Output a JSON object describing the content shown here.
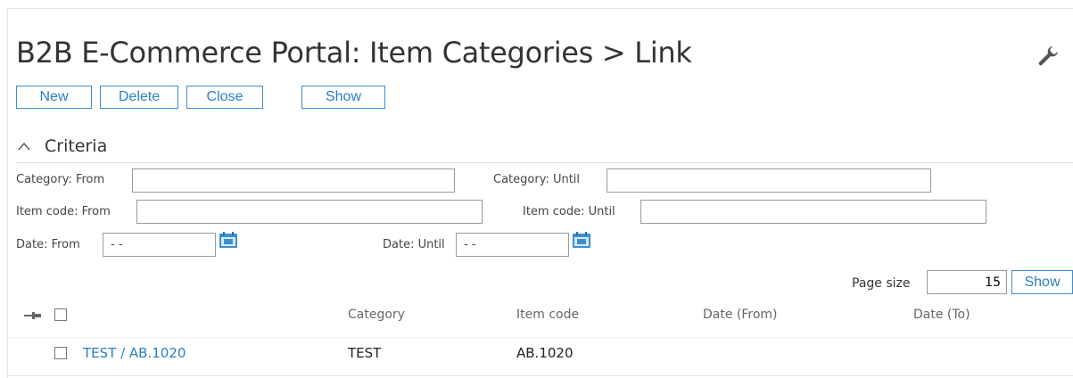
{
  "page": {
    "title": "B2B E-Commerce Portal: Item Categories > Link",
    "settings_icon": "wrench-icon"
  },
  "toolbar": {
    "new_label": "New",
    "delete_label": "Delete",
    "close_label": "Close",
    "show_label": "Show"
  },
  "criteria": {
    "heading": "Criteria",
    "category_from_label": "Category: From",
    "category_from_value": "",
    "category_until_label": "Category: Until",
    "category_until_value": "",
    "item_from_label": "Item code: From",
    "item_from_value": "",
    "item_until_label": "Item code: Until",
    "item_until_value": "",
    "date_from_label": "Date: From",
    "date_from_value": "- -",
    "date_until_label": "Date: Until",
    "date_until_value": "- -"
  },
  "paging": {
    "page_size_label": "Page size",
    "page_size_value": "15",
    "show_label": "Show"
  },
  "table": {
    "columns": [
      "Category",
      "Item code",
      "Date (From)",
      "Date (To)"
    ],
    "rows": [
      {
        "link": "TEST / AB.1020",
        "category": "TEST",
        "item_code": "AB.1020",
        "date_from": "",
        "date_to": ""
      }
    ]
  },
  "colors": {
    "accent": "#2a7fc5",
    "calendar": "#3a8fd0"
  }
}
